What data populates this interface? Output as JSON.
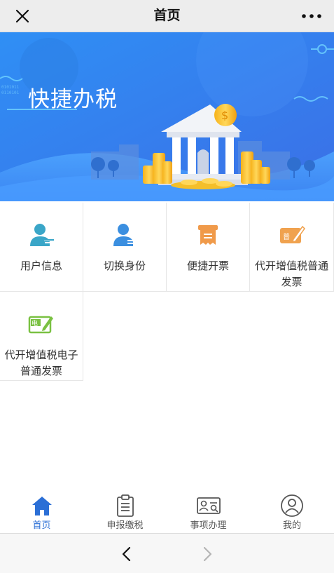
{
  "header": {
    "title": "首页"
  },
  "banner": {
    "title": "快捷办税"
  },
  "grid": {
    "items": [
      {
        "label": "用户信息",
        "icon": "user-info-icon"
      },
      {
        "label": "切换身份",
        "icon": "switch-identity-icon"
      },
      {
        "label": "便捷开票",
        "icon": "invoice-icon"
      },
      {
        "label": "代开增值税普通发票",
        "icon": "vat-invoice-icon",
        "badge": "普"
      },
      {
        "label": "代开增值税电子普通发票",
        "icon": "e-invoice-icon",
        "badge": "电"
      }
    ]
  },
  "tabbar": {
    "items": [
      {
        "label": "首页",
        "icon": "home-icon",
        "active": true
      },
      {
        "label": "申报缴税",
        "icon": "clipboard-icon",
        "active": false
      },
      {
        "label": "事项办理",
        "icon": "id-card-search-icon",
        "active": false
      },
      {
        "label": "我的",
        "icon": "profile-icon",
        "active": false
      }
    ]
  },
  "colors": {
    "accent": "#2b6fd6",
    "banner_blue": "#3d86f0",
    "user_icon_teal": "#3aa6c8",
    "invoice_orange": "#f09a4a",
    "e_invoice_green": "#7ac142"
  }
}
